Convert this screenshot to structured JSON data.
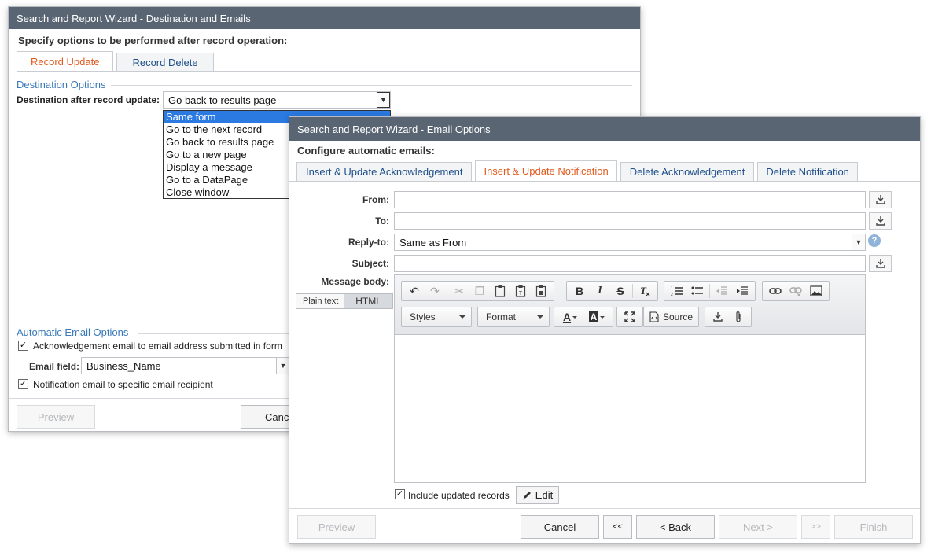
{
  "back_dialog": {
    "title": "Search and Report Wizard - Destination and Emails",
    "heading": "Specify options to be performed after record operation:",
    "tabs": [
      "Record Update",
      "Record Delete"
    ],
    "destination_legend": "Destination Options",
    "destination_label": "Destination after record update:",
    "destination_value": "Go back to results page",
    "destination_options": [
      "Same form",
      "Go to the next record",
      "Go back to results page",
      "Go to a new page",
      "Display a message",
      "Go to a DataPage",
      "Close window"
    ],
    "email_legend": "Automatic Email Options",
    "ack_checkbox_label": "Acknowledgement email to email address submitted in form",
    "email_field_label": "Email field:",
    "email_field_value": "Business_Name",
    "notif_checkbox_label": "Notification email to specific email recipient",
    "preview_label": "Preview",
    "cancel_label": "Cancel"
  },
  "front_dialog": {
    "title": "Search and Report Wizard - Email Options",
    "heading": "Configure automatic emails:",
    "tabs": [
      "Insert & Update Acknowledgement",
      "Insert & Update Notification",
      "Delete Acknowledgement",
      "Delete Notification"
    ],
    "active_tab_index": 1,
    "labels": {
      "from": "From:",
      "to": "To:",
      "reply_to": "Reply-to:",
      "subject": "Subject:",
      "message_body": "Message body:"
    },
    "reply_to_value": "Same as From",
    "mode_plain": "Plain text",
    "mode_html": "HTML",
    "toolbar": {
      "styles": "Styles",
      "format": "Format",
      "source": "Source",
      "bold": "B",
      "italic": "I",
      "strike": "S",
      "text_color": "A",
      "bg_color": "A"
    },
    "include_label": "Include updated records",
    "edit_label": "Edit",
    "buttons": {
      "preview": "Preview",
      "cancel": "Cancel",
      "first": "<<",
      "back": "< Back",
      "next": "Next >",
      "last": ">>",
      "finish": "Finish"
    }
  },
  "colors": {
    "titlebar": "#5a6574",
    "active_tab": "#e05a1e",
    "tab_text": "#1e4f8a",
    "legend": "#3a7ab8",
    "selection": "#2a7ae2"
  }
}
